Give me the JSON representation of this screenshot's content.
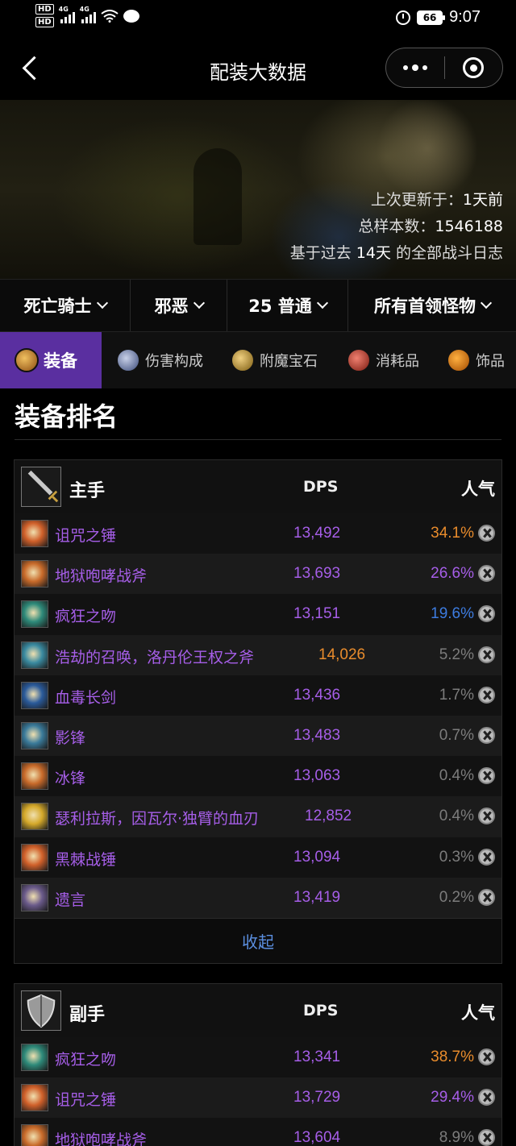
{
  "status_bar": {
    "network_badge": "HD",
    "network_type": "4G",
    "battery": "66",
    "time": "9:07"
  },
  "nav": {
    "title": "配装大数据",
    "icons": {
      "back": "chevron-left-icon",
      "more": "more-dots-icon",
      "close": "target-circle-icon"
    }
  },
  "hero": {
    "updated_label": "上次更新于：",
    "updated_value": "1天前",
    "samples_label": "总样本数：",
    "samples_value": "1546188",
    "basis_prefix": "基于过去 ",
    "basis_value": "14天",
    "basis_suffix": " 的全部战斗日志"
  },
  "filters": [
    {
      "label": "死亡骑士"
    },
    {
      "label": "邪恶"
    },
    {
      "label": "25 普通"
    },
    {
      "label": "所有首领怪物"
    }
  ],
  "tabs": [
    {
      "label": "装备",
      "icon": "gear-equipment-icon",
      "color": "#c8882a",
      "active": true
    },
    {
      "label": "伤害构成",
      "icon": "sword-icon",
      "color": "#6a7aa8",
      "active": false
    },
    {
      "label": "附魔宝石",
      "icon": "gem-icon",
      "color": "#c89a3a",
      "active": false
    },
    {
      "label": "消耗品",
      "icon": "potion-icon",
      "color": "#c23a2a",
      "active": false
    },
    {
      "label": "饰品",
      "icon": "trinket-icon",
      "color": "#e0801a",
      "active": false
    }
  ],
  "section_title": "装备排名",
  "colors": {
    "accent_tab": "#5a2fa0",
    "epic_purple": "#a65ee8",
    "legendary_orange": "#e98c2c",
    "rare_blue": "#3d7ce0",
    "link_blue": "#5b8fe0"
  },
  "main_hand": {
    "label": "主手",
    "dps_header": "DPS",
    "popularity_header": "人气",
    "slot_icon": "sword-icon",
    "items": [
      {
        "name": "诅咒之锤",
        "dps": "13,492",
        "pop": "34.1%",
        "icon": "mace-icon",
        "icon_color": "#d0602a",
        "dps_class": "",
        "pop_class": "orange"
      },
      {
        "name": "地狱咆哮战斧",
        "dps": "13,693",
        "pop": "26.6%",
        "icon": "axe-icon",
        "icon_color": "#c86a2a",
        "dps_class": "",
        "pop_class": "purple"
      },
      {
        "name": "疯狂之吻",
        "dps": "13,151",
        "pop": "19.6%",
        "icon": "kiss-icon",
        "icon_color": "#2e8a7a",
        "dps_class": "",
        "pop_class": "blue"
      },
      {
        "name": "浩劫的召唤，洛丹伦王权之斧",
        "dps": "14,026",
        "pop": "5.2%",
        "icon": "axe-icon",
        "icon_color": "#3a8aa0",
        "dps_class": "orange shift2",
        "pop_class": ""
      },
      {
        "name": "血毒长剑",
        "dps": "13,436",
        "pop": "1.7%",
        "icon": "blade-icon",
        "icon_color": "#2a5a9a",
        "dps_class": "",
        "pop_class": ""
      },
      {
        "name": "影锋",
        "dps": "13,483",
        "pop": "0.7%",
        "icon": "blade-icon",
        "icon_color": "#3a7a9a",
        "dps_class": "",
        "pop_class": ""
      },
      {
        "name": "冰锋",
        "dps": "13,063",
        "pop": "0.4%",
        "icon": "axe-icon",
        "icon_color": "#c86a2a",
        "dps_class": "",
        "pop_class": ""
      },
      {
        "name": "瑟利拉斯，因瓦尔·独臂的血刃",
        "dps": "12,852",
        "pop": "0.4%",
        "icon": "sword-icon",
        "icon_color": "#d4a82a",
        "dps_class": "shift1",
        "pop_class": ""
      },
      {
        "name": "黑棘战锤",
        "dps": "13,094",
        "pop": "0.3%",
        "icon": "mace-icon",
        "icon_color": "#d0602a",
        "dps_class": "",
        "pop_class": ""
      },
      {
        "name": "遗言",
        "dps": "13,419",
        "pop": "0.2%",
        "icon": "staff-icon",
        "icon_color": "#6a5a8a",
        "dps_class": "",
        "pop_class": ""
      }
    ],
    "collapse_label": "收起"
  },
  "off_hand": {
    "label": "副手",
    "dps_header": "DPS",
    "popularity_header": "人气",
    "slot_icon": "shield-icon",
    "items": [
      {
        "name": "疯狂之吻",
        "dps": "13,341",
        "pop": "38.7%",
        "icon": "kiss-icon",
        "icon_color": "#2e8a7a",
        "dps_class": "",
        "pop_class": "orange"
      },
      {
        "name": "诅咒之锤",
        "dps": "13,729",
        "pop": "29.4%",
        "icon": "mace-icon",
        "icon_color": "#d0602a",
        "dps_class": "",
        "pop_class": "purple"
      },
      {
        "name": "地狱咆哮战斧",
        "dps": "13,604",
        "pop": "8.9%",
        "icon": "axe-icon",
        "icon_color": "#c86a2a",
        "dps_class": "",
        "pop_class": ""
      }
    ]
  }
}
